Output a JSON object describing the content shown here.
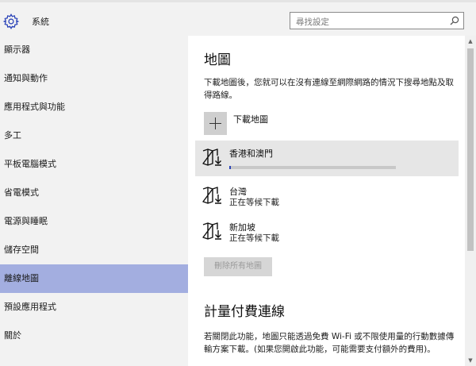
{
  "app": {
    "title": "系統"
  },
  "search": {
    "placeholder": "尋找設定"
  },
  "sidebar": {
    "items": [
      {
        "label": "顯示器"
      },
      {
        "label": "通知與動作"
      },
      {
        "label": "應用程式與功能"
      },
      {
        "label": "多工"
      },
      {
        "label": "平板電腦模式"
      },
      {
        "label": "省電模式"
      },
      {
        "label": "電源與睡眠"
      },
      {
        "label": "儲存空間"
      },
      {
        "label": "離線地圖"
      },
      {
        "label": "預設應用程式"
      },
      {
        "label": "關於"
      }
    ],
    "active_index": 8
  },
  "main": {
    "title": "地圖",
    "description": "下載地圖後，您就可以在沒有連線至網際網路的情況下搜尋地點及取得路線。",
    "download_label": "下載地圖",
    "maps": [
      {
        "name": "香港和澳門",
        "status": "",
        "progress": 0.01
      },
      {
        "name": "台灣",
        "status": "正在等候下載"
      },
      {
        "name": "新加坡",
        "status": "正在等候下載"
      }
    ],
    "delete_all_label": "刪除所有地圖",
    "metered_title": "計量付費連線",
    "metered_description": "若關閉此功能，地圖只能透過免費 Wi-Fi 或不限使用量的行動數據傳輸方案下載。(如果您開啟此功能，可能需要支付額外的費用)。"
  },
  "colors": {
    "accent": "#2a43b8",
    "sidebar_bg": "#f2f2f2",
    "selected_nav": "#a3aee0"
  },
  "icons": [
    "gear-icon",
    "search-icon",
    "plus-icon",
    "map-download-icon"
  ]
}
